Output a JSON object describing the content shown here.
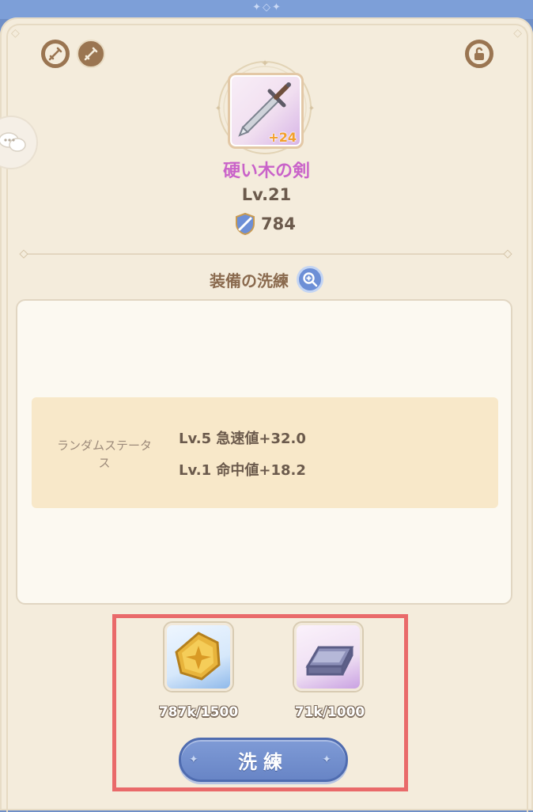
{
  "item": {
    "name": "硬い木の剣",
    "enhance": "+24",
    "level": "Lv.21",
    "power": "784"
  },
  "icons": {
    "top_left_1": "sword-ring-icon",
    "top_left_2": "sword-icon",
    "top_right": "lock-ring-icon",
    "chat": "chat-bubble-icon",
    "power": "shield-sword-icon",
    "magnify": "magnify-plus-icon"
  },
  "refine": {
    "section_title": "装備の洗練",
    "random_status_label": "ランダムステータス",
    "stats": [
      "Lv.5 急速値+32.0",
      "Lv.1 命中値+18.2"
    ]
  },
  "materials": [
    {
      "icon": "gold-coin-icon",
      "count": "787k/1500"
    },
    {
      "icon": "iron-ingot-icon",
      "count": "71k/1000"
    }
  ],
  "button": {
    "label": "洗練"
  },
  "colors": {
    "item_name": "#c963c9",
    "button": "#6f8bcf",
    "highlight_box": "#e96a6a",
    "enhance": "#f3a02b"
  }
}
